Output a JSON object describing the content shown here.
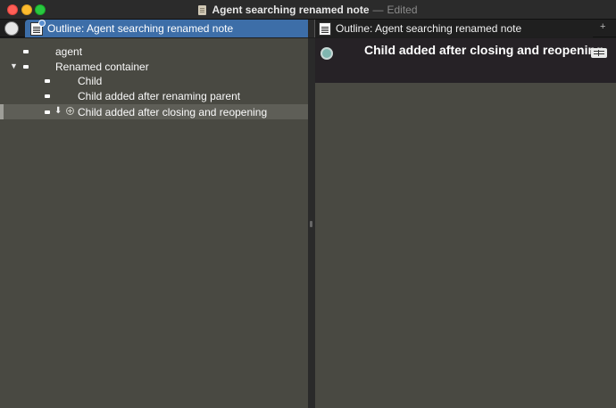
{
  "window": {
    "title": "Agent searching renamed note",
    "separator": "—",
    "status": "Edited"
  },
  "tabs": [
    {
      "label": "Outline: Agent searching renamed note",
      "active": true
    },
    {
      "label": "Outline: Agent searching renamed note",
      "active": false
    }
  ],
  "tab_add": "+",
  "outline": {
    "rows": [
      {
        "label": "agent",
        "level": 0,
        "expanded": null
      },
      {
        "label": "Renamed container",
        "level": 0,
        "expanded": true
      },
      {
        "label": "Child",
        "level": 1,
        "expanded": null
      },
      {
        "label": "Child added after renaming parent",
        "level": 1,
        "expanded": null
      },
      {
        "label": "Child added after closing and reopening",
        "level": 1,
        "expanded": null,
        "selected": true
      }
    ]
  },
  "note": {
    "title": "Child added after closing and reopening"
  },
  "colors": {
    "active_tab": "#3d6ea8",
    "pane_bg": "#494942",
    "note_header_bg": "#262226",
    "note_badge": "#7fb6b0"
  }
}
